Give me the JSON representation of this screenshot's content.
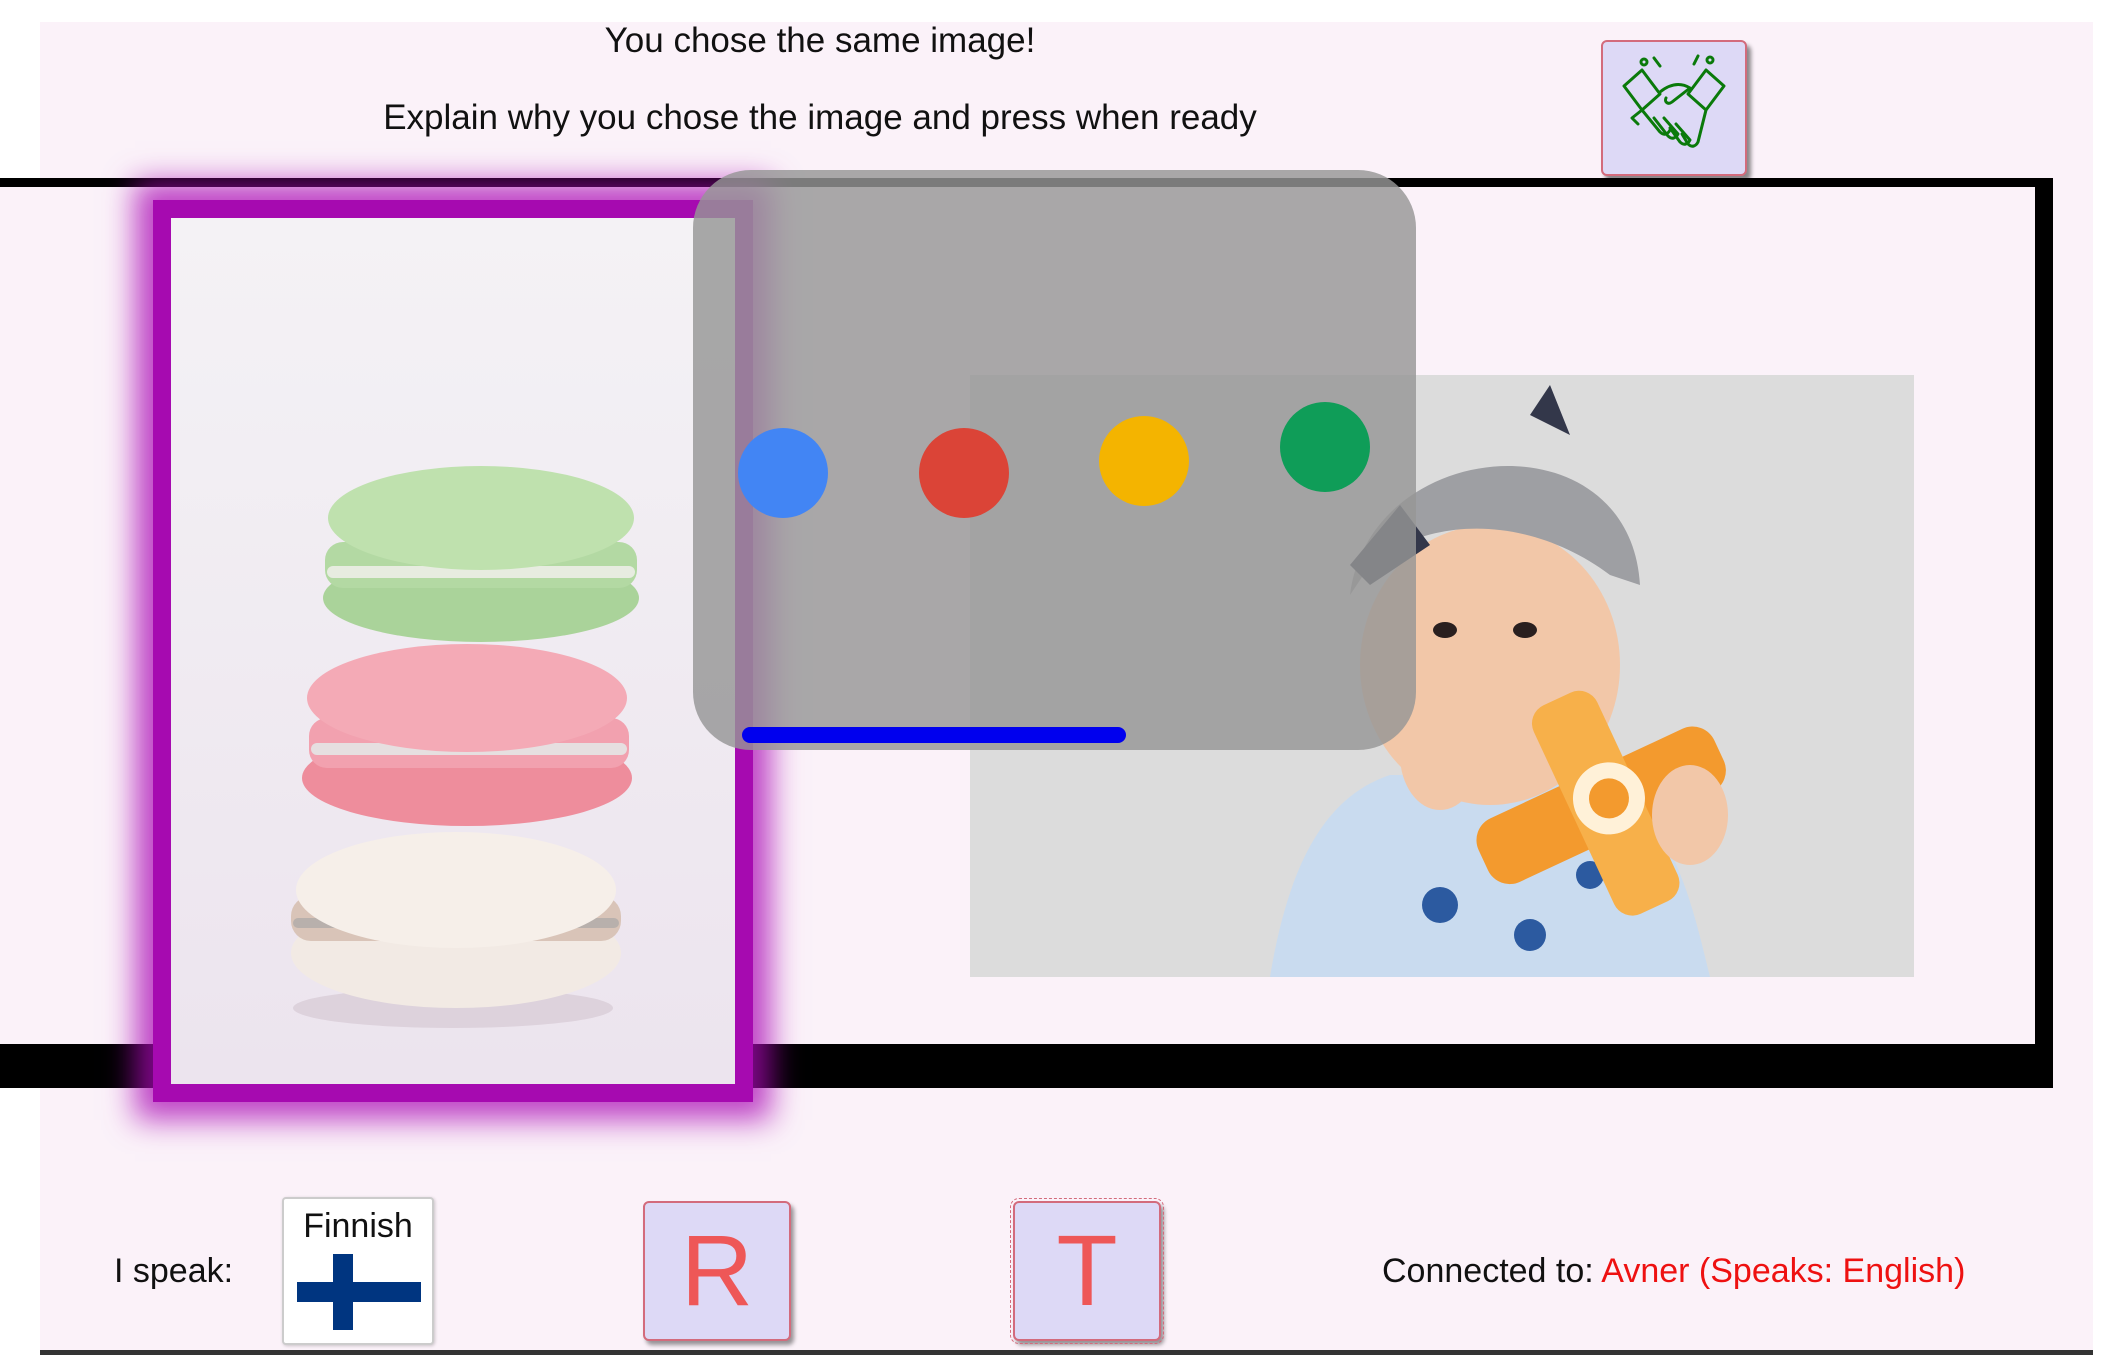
{
  "header": {
    "line1": "You chose the same image!",
    "line2": "Explain why you chose the image and press when ready",
    "ready_button_icon": "handshake-icon",
    "ready_button_color": "#0a7a0a"
  },
  "images": [
    {
      "subject": "stacked-macarons-image",
      "selected": true
    },
    {
      "subject": "baby-with-toy-airplane-image",
      "selected": false
    }
  ],
  "selection_color": "#a60ab0",
  "speech_indicator": {
    "dots": [
      "#4285f4",
      "#db4437",
      "#f4b400",
      "#0f9d58"
    ],
    "level_bar_color": "#0000ee"
  },
  "footer": {
    "speak_label": "I speak:",
    "language": "Finnish",
    "language_flag": "finland-flag-icon",
    "button_r": "R",
    "button_t": "T",
    "connected_label": "Connected to: ",
    "partner": "Avner (Speaks: English)"
  }
}
